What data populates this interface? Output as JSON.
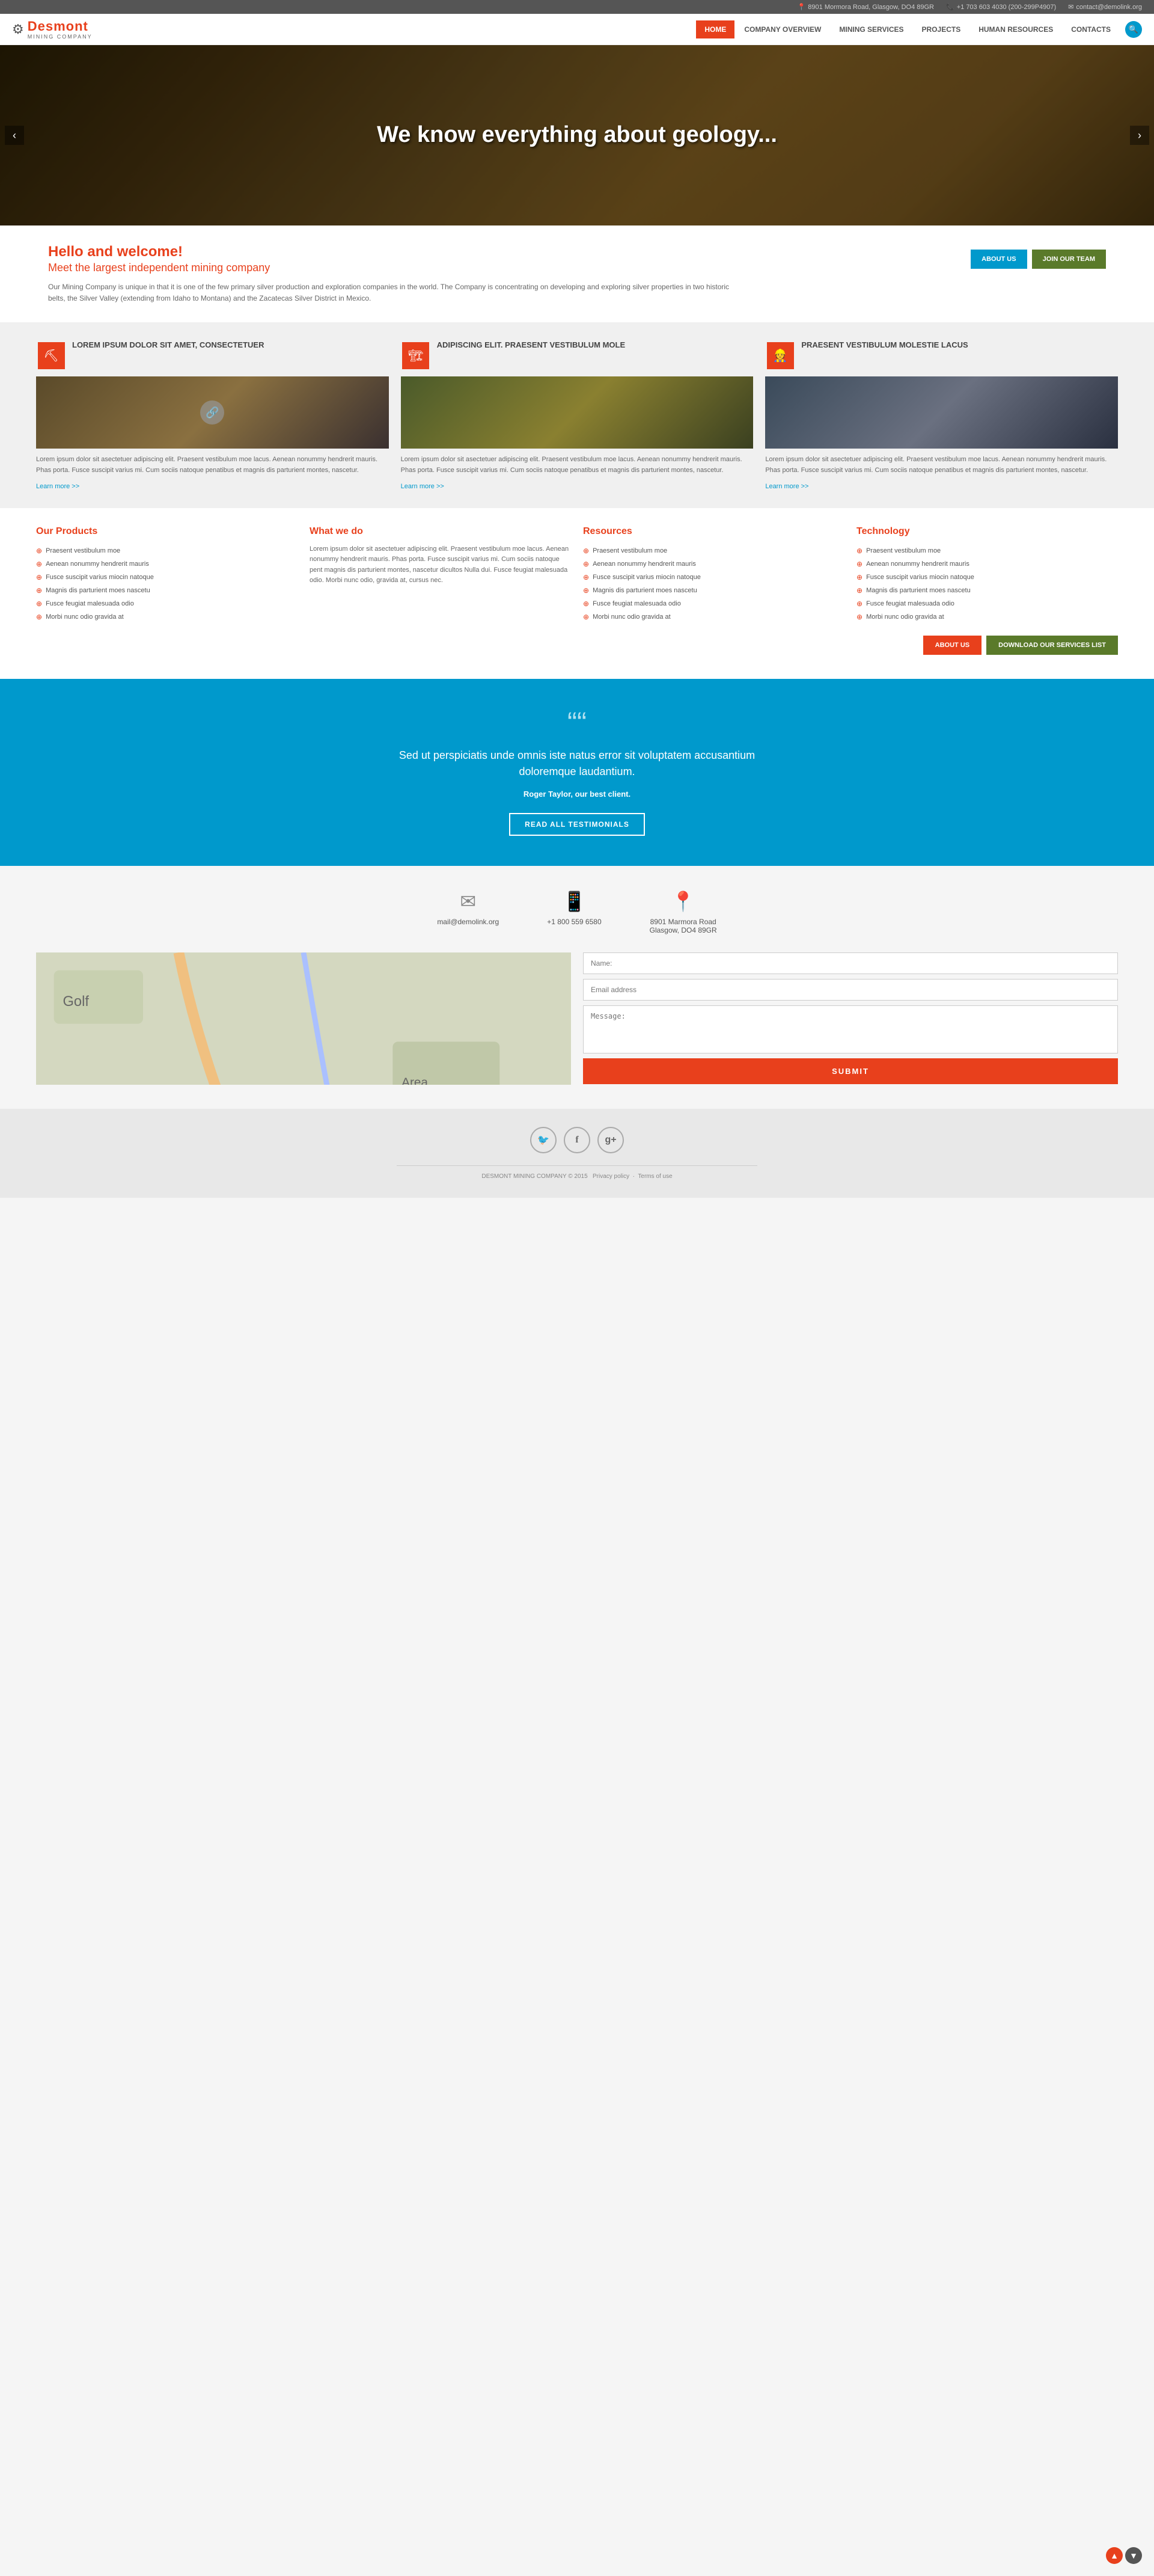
{
  "topbar": {
    "address": "8901 Mormora Road, Glasgow, DO4 89GR",
    "phone": "+1 703 603 4030 (200-299P4907)",
    "email": "contact@demolink.org"
  },
  "header": {
    "logo_name": "Desmont",
    "logo_sub": "MINING COMPANY",
    "nav": [
      {
        "label": "HOME",
        "active": true
      },
      {
        "label": "COMPANY OVERVIEW",
        "active": false
      },
      {
        "label": "MINING SERVICES",
        "active": false
      },
      {
        "label": "PROJECTS",
        "active": false
      },
      {
        "label": "HUMAN RESOURCES",
        "active": false
      },
      {
        "label": "CONTACTS",
        "active": false
      }
    ]
  },
  "hero": {
    "title": "We know everything about geology...",
    "prev_label": "‹",
    "next_label": "›"
  },
  "welcome": {
    "title": "Hello and welcome!",
    "subtitle": "Meet the largest independent mining company",
    "description": "Our Mining Company is unique in that it is one of the few primary silver production and exploration companies in the world. The Company is concentrating on developing and exploring silver properties in two historic belts, the Silver Valley (extending from Idaho to Montana) and the Zacatecas Silver District in Mexico.",
    "btn_about": "ABOUT US",
    "btn_join": "JOIN OUR TEAM"
  },
  "services": [
    {
      "title": "LOREM IPSUM DOLOR SIT AMET, CONSECTETUER",
      "description": "Lorem ipsum dolor sit asectetuer adipiscing elit. Praesent vestibulum moe lacus. Aenean nonummy hendrerit mauris. Phas porta. Fusce suscipit varius mi. Cum sociis natoque penatibus et magnis dis parturient montes, nascetur.",
      "learn_more": "Learn more >>"
    },
    {
      "title": "ADIPISCING ELIT. PRAESENT VESTIBULUM MOLE",
      "description": "Lorem ipsum dolor sit asectetuer adipiscing elit. Praesent vestibulum moe lacus. Aenean nonummy hendrerit mauris. Phas porta. Fusce suscipit varius mi. Cum sociis natoque penatibus et magnis dis parturient montes, nascetur.",
      "learn_more": "Learn more >>"
    },
    {
      "title": "PRAESENT VESTIBULUM MOLESTIE LACUS",
      "description": "Lorem ipsum dolor sit asectetuer adipiscing elit. Praesent vestibulum moe lacus. Aenean nonummy hendrerit mauris. Phas porta. Fusce suscipit varius mi. Cum sociis natoque penatibus et magnis dis parturient montes, nascetur.",
      "learn_more": "Learn more >>"
    }
  ],
  "products": {
    "col1": {
      "title": "Our Products",
      "items": [
        "Praesent vestibulum moe",
        "Aenean nonummy hendrerit mauris",
        "Fusce suscipit varius miocin natoque",
        "Magnis dis parturient moes nascetu",
        "Fusce feugiat malesuada odio",
        "Morbi nunc odio gravida at"
      ]
    },
    "col2": {
      "title": "What we do",
      "text": "Lorem ipsum dolor sit asectetuer adipiscing elit. Praesent vestibulum moe lacus. Aenean nonummy hendrerit mauris. Phas porta. Fusce suscipit varius mi. Cum sociis natoque pent magnis dis parturient montes, nascetur dicultos Nulla dui. Fusce feugiat malesuada odio. Morbi nunc odio, gravida at, cursus nec."
    },
    "col3": {
      "title": "Resources",
      "items": [
        "Praesent vestibulum moe",
        "Aenean nonummy hendrerit mauris",
        "Fusce suscipit varius miocin natoque",
        "Magnis dis parturient moes nascetu",
        "Fusce feugiat malesuada odio",
        "Morbi nunc odio gravida at"
      ]
    },
    "col4": {
      "title": "Technology",
      "items": [
        "Praesent vestibulum moe",
        "Aenean nonummy hendrerit mauris",
        "Fusce suscipit varius miocin natoque",
        "Magnis dis parturient moes nascetu",
        "Fusce feugiat malesuada odio",
        "Morbi nunc odio gravida at"
      ]
    },
    "btn_about": "ABOUT US",
    "btn_download": "DOWNLOAD OUR SERVICES LIST"
  },
  "testimonial": {
    "quote_icon": "““",
    "text": "Sed ut perspiciatis unde omnis iste natus error sit voluptatem accusantium doloremque laudantium.",
    "author": "Roger Taylor, our best client.",
    "btn_label": "READ ALL TESTIMONIALS"
  },
  "contact": {
    "email": "mail@demolink.org",
    "phone": "+1 800 559 6580",
    "address_line1": "8901 Marmora Road",
    "address_line2": "Glasgow, DO4 89GR",
    "form": {
      "name_placeholder": "Name:",
      "email_placeholder": "Email address",
      "message_placeholder": "Message:",
      "submit_label": "SUBMIT"
    }
  },
  "footer": {
    "copyright": "DESMONT MINING COMPANY © 2015",
    "privacy": "Privacy policy",
    "terms": "Terms of use",
    "social": [
      {
        "name": "twitter",
        "icon": "🐦"
      },
      {
        "name": "facebook",
        "icon": "f"
      },
      {
        "name": "googleplus",
        "icon": "g+"
      }
    ]
  }
}
